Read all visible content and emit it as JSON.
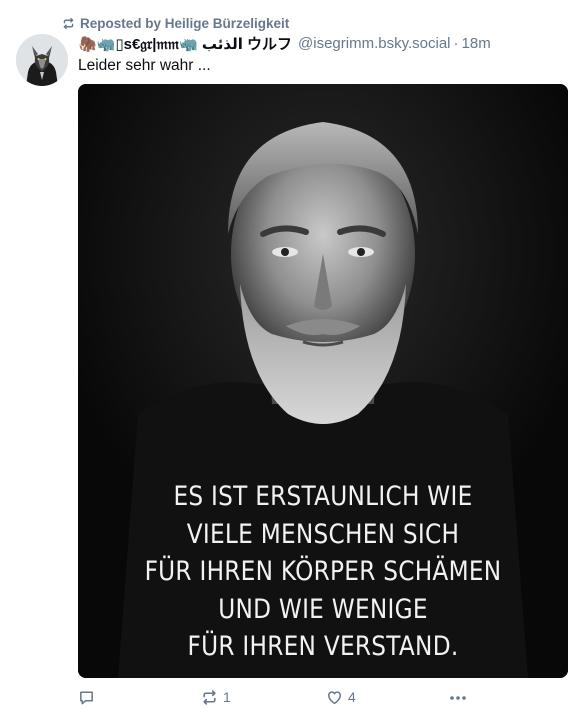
{
  "repost": {
    "label": "Reposted by Heilige Bürzeligkeit",
    "icon": "repost-icon"
  },
  "post": {
    "author": {
      "display_name": "🦣🦏▯s€𝔤𝔯|𝔪𝔪🦏 الذئب ウルフ",
      "handle": "@isegrimm.bsky.social",
      "separator": "·",
      "time": "18m",
      "avatar_icon": "wolf-avatar"
    },
    "text": "Leider sehr wahr ...",
    "image": {
      "quote_lines": [
        "ES IST ERSTAUNLICH WIE",
        "VIELE MENSCHEN SICH",
        "FÜR IHREN KÖRPER SCHÄMEN",
        "UND WIE WENIGE",
        "FÜR IHREN VERSTAND."
      ]
    },
    "actions": {
      "reply_count": "",
      "repost_count": "1",
      "like_count": "4"
    }
  },
  "colors": {
    "muted": "#66788a",
    "text": "#0b0f14",
    "image_bg": "#0d0d0d"
  }
}
